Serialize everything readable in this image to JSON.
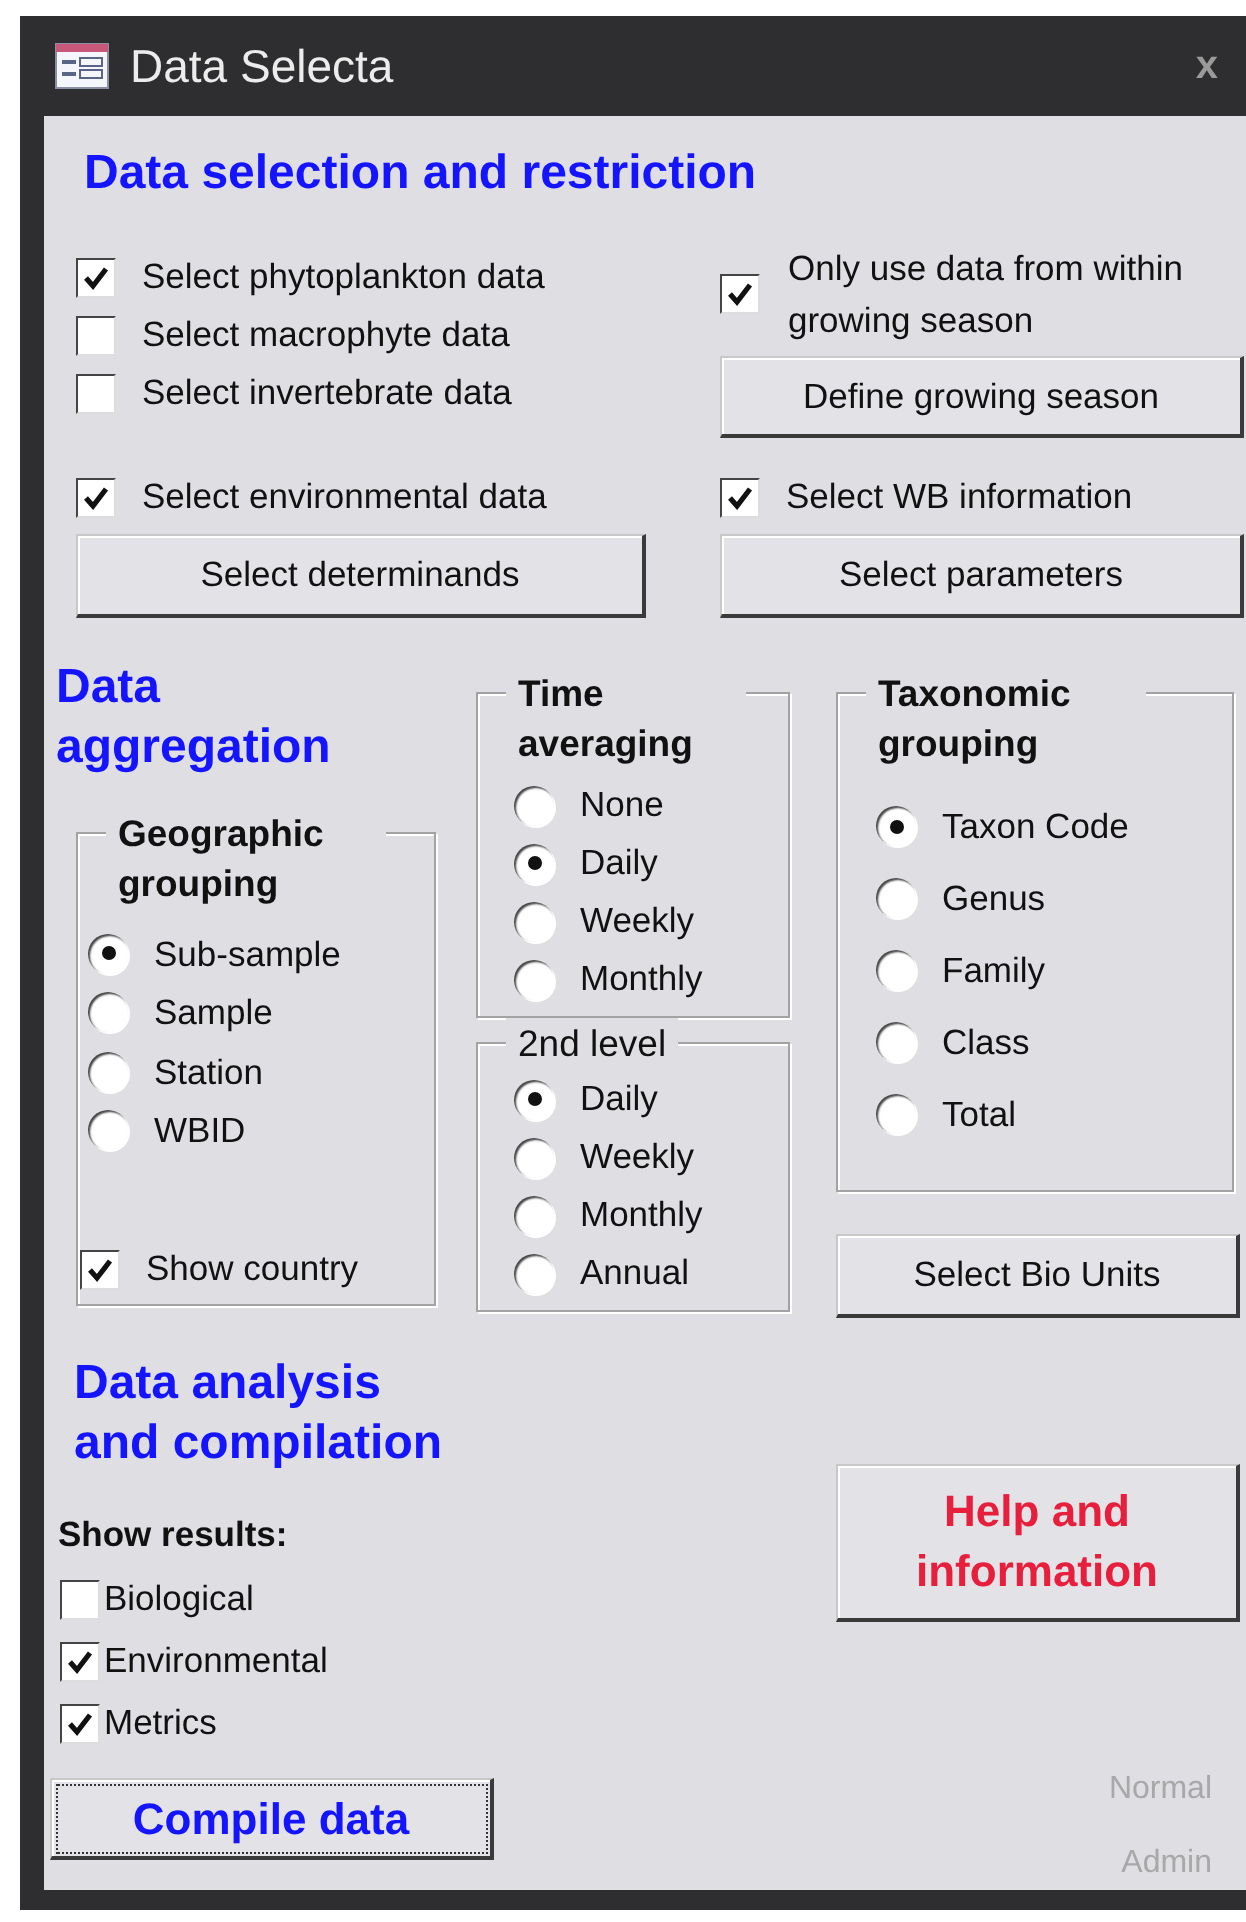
{
  "window": {
    "title": "Data Selecta",
    "close": "x"
  },
  "selection": {
    "heading": "Data selection and restriction",
    "data_checks": [
      {
        "label": "Select phytoplankton data",
        "checked": true
      },
      {
        "label": "Select macrophyte data",
        "checked": false
      },
      {
        "label": "Select invertebrate data",
        "checked": false
      }
    ],
    "season_check": {
      "label": "Only use data from within growing season",
      "checked": true
    },
    "define_button": "Define growing season",
    "env_check": {
      "label": "Select environmental data",
      "checked": true
    },
    "wb_check": {
      "label": "Select WB information",
      "checked": true
    },
    "determinands_button": "Select determinands",
    "parameters_button": "Select parameters"
  },
  "aggregation": {
    "heading": "Data aggregation",
    "geographic": {
      "legend": "Geographic grouping",
      "options": [
        {
          "label": "Sub-sample",
          "selected": true
        },
        {
          "label": "Sample",
          "selected": false
        },
        {
          "label": "Station",
          "selected": false
        },
        {
          "label": "WBID",
          "selected": false
        }
      ],
      "show_country": {
        "label": "Show country",
        "checked": true
      }
    },
    "time": {
      "legend": "Time averaging",
      "options": [
        {
          "label": "None",
          "selected": false
        },
        {
          "label": "Daily",
          "selected": true
        },
        {
          "label": "Weekly",
          "selected": false
        },
        {
          "label": "Monthly",
          "selected": false
        }
      ]
    },
    "second_level": {
      "legend": "2nd level",
      "options": [
        {
          "label": "Daily",
          "selected": true
        },
        {
          "label": "Weekly",
          "selected": false
        },
        {
          "label": "Monthly",
          "selected": false
        },
        {
          "label": "Annual",
          "selected": false
        }
      ]
    },
    "taxonomic": {
      "legend": "Taxonomic grouping",
      "options": [
        {
          "label": "Taxon Code",
          "selected": true
        },
        {
          "label": "Genus",
          "selected": false
        },
        {
          "label": "Family",
          "selected": false
        },
        {
          "label": "Class",
          "selected": false
        },
        {
          "label": "Total",
          "selected": false
        }
      ]
    },
    "bio_units_button": "Select Bio Units"
  },
  "analysis": {
    "heading": "Data analysis and compilation",
    "results_label": "Show results:",
    "results": [
      {
        "label": "Biological",
        "checked": false
      },
      {
        "label": "Environmental",
        "checked": true
      },
      {
        "label": "Metrics",
        "checked": true
      }
    ],
    "compile_button": "Compile data",
    "help_button": "Help and information",
    "mode_labels": [
      "Normal",
      "Admin"
    ]
  }
}
